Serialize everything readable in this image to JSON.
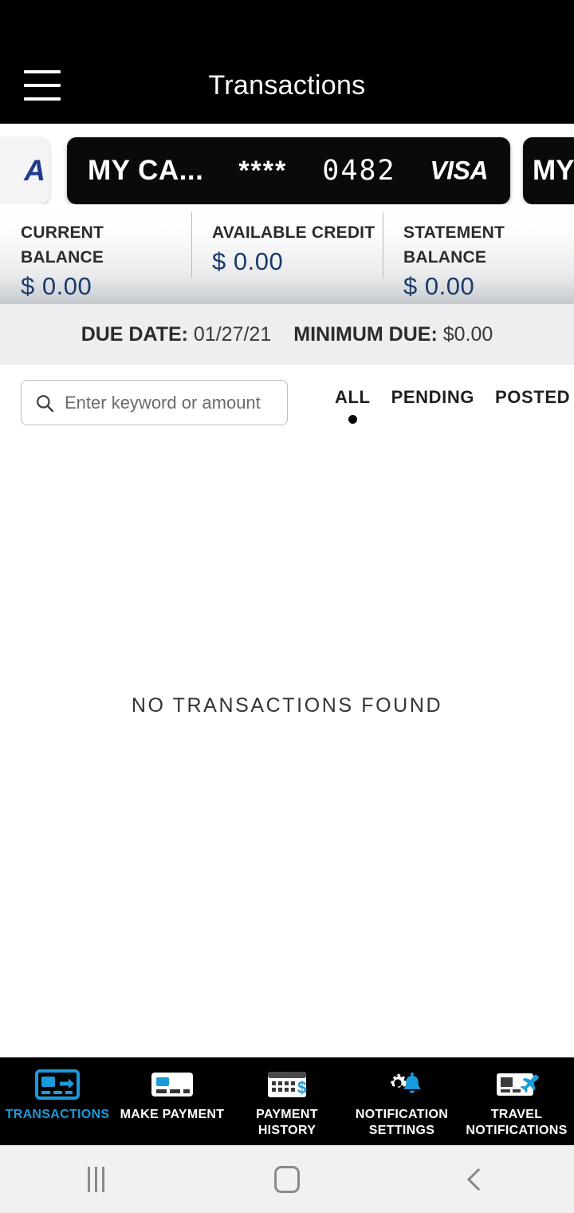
{
  "header": {
    "title": "Transactions",
    "menu_icon": "hamburger-menu-icon"
  },
  "cards": {
    "previous": {
      "logo_text": "A"
    },
    "current": {
      "nickname": "MY CA...",
      "mask": "****",
      "last_four": "0482",
      "brand": "VISA"
    },
    "next": {
      "nickname": "MY"
    }
  },
  "balances": [
    {
      "label": "CURRENT BALANCE",
      "value": "$ 0.00"
    },
    {
      "label": "AVAILABLE CREDIT",
      "value": "$ 0.00"
    },
    {
      "label": "STATEMENT BALANCE",
      "value": "$ 0.00"
    }
  ],
  "due_info": {
    "due_date_label": "DUE DATE:",
    "due_date_value": "01/27/21",
    "minimum_due_label": "MINIMUM DUE:",
    "minimum_due_value": "$0.00"
  },
  "search": {
    "placeholder": "Enter keyword or amount",
    "value": "",
    "icon": "search-icon"
  },
  "filter_tabs": [
    {
      "label": "ALL",
      "active": true
    },
    {
      "label": "PENDING",
      "active": false
    },
    {
      "label": "POSTED",
      "active": false
    }
  ],
  "empty_state": {
    "message": "NO TRANSACTIONS FOUND"
  },
  "bottom_nav": [
    {
      "label": "TRANSACTIONS",
      "icon": "card-transfer-icon",
      "active": true
    },
    {
      "label": "MAKE PAYMENT",
      "icon": "credit-card-icon",
      "active": false
    },
    {
      "label": "PAYMENT HISTORY",
      "icon": "calendar-dollar-icon",
      "active": false
    },
    {
      "label": "NOTIFICATION SETTINGS",
      "icon": "gear-bell-icon",
      "active": false
    },
    {
      "label": "TRAVEL NOTIFICATIONS",
      "icon": "card-airplane-icon",
      "active": false
    }
  ],
  "system_nav": {
    "recents": "recents-icon",
    "home": "home-icon",
    "back": "back-icon"
  },
  "colors": {
    "header_bg": "#000000",
    "balance_value": "#1b3a6b",
    "nav_active": "#1a9bdc",
    "due_band_bg": "#edeef0"
  }
}
